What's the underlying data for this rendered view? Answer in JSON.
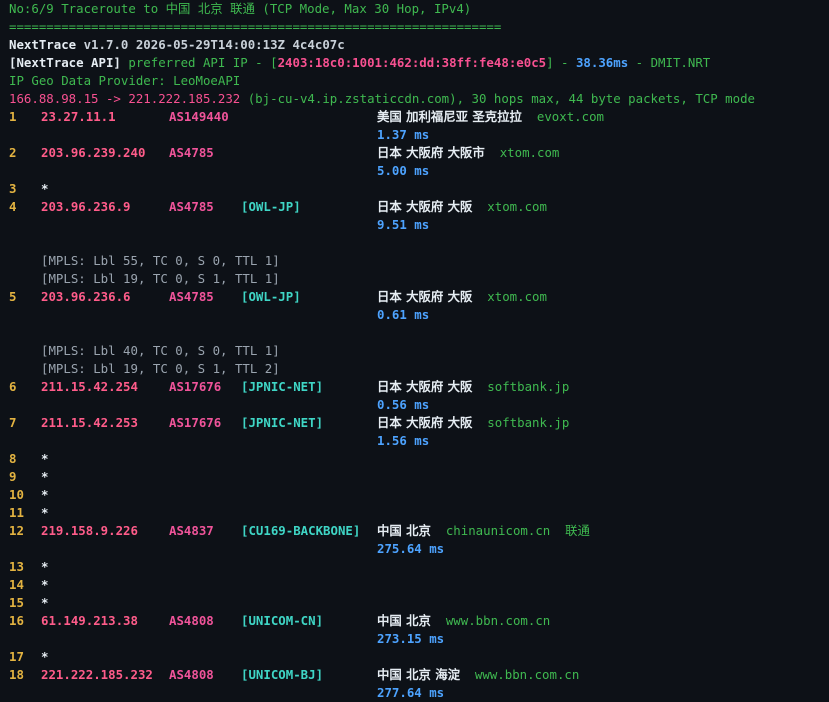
{
  "header": {
    "title": "No:6/9 Traceroute to 中国 北京 联通 (TCP Mode, Max 30 Hop, IPv4)",
    "separator": "==================================================================",
    "version_name": "NextTrace",
    "version_rest": " v1.7.0 2026-05-29T14:00:13Z 4c4c07c",
    "api_label": "[NextTrace API]",
    "api_mid": " preferred API IP - [",
    "api_ip": "2403:18c0:1001:462:dd:38ff:fe48:e0c5",
    "api_after": "] - ",
    "api_latency": "38.36ms",
    "api_end": " - DMIT.NRT",
    "geo_provider": "IP Geo Data Provider: LeoMoeAPI",
    "route_summary": "166.88.98.15 -> 221.222.185.232 (bj-cu-v4.ip.zstaticcdn.com), 30 hops max, 44 byte packets, TCP mode"
  },
  "hops": [
    {
      "num": "1",
      "ip": "23.27.11.1",
      "asn": "AS149440",
      "tag": "",
      "geo": "美国 加利福尼亚 圣克拉拉",
      "domain": "evoxt.com",
      "latency": "1.37 ms",
      "mpls": []
    },
    {
      "num": "2",
      "ip": "203.96.239.240",
      "asn": "AS4785",
      "tag": "",
      "geo": "日本 大阪府 大阪市",
      "domain": "xtom.com",
      "latency": "5.00 ms",
      "mpls": []
    },
    {
      "num": "3",
      "star": "*"
    },
    {
      "num": "4",
      "ip": "203.96.236.9",
      "asn": "AS4785",
      "tag": "[OWL-JP]",
      "geo": "日本 大阪府 大阪",
      "domain": "xtom.com",
      "latency": "9.51 ms",
      "mpls": [
        "[MPLS: Lbl 55, TC 0, S 0, TTL 1]",
        "[MPLS: Lbl 19, TC 0, S 1, TTL 1]"
      ]
    },
    {
      "num": "5",
      "ip": "203.96.236.6",
      "asn": "AS4785",
      "tag": "[OWL-JP]",
      "geo": "日本 大阪府 大阪",
      "domain": "xtom.com",
      "latency": "0.61 ms",
      "mpls": [
        "[MPLS: Lbl 40, TC 0, S 0, TTL 1]",
        "[MPLS: Lbl 19, TC 0, S 1, TTL 2]"
      ]
    },
    {
      "num": "6",
      "ip": "211.15.42.254",
      "asn": "AS17676",
      "tag": "[JPNIC-NET]",
      "geo": "日本 大阪府 大阪",
      "domain": "softbank.jp",
      "latency": "0.56 ms",
      "mpls": []
    },
    {
      "num": "7",
      "ip": "211.15.42.253",
      "asn": "AS17676",
      "tag": "[JPNIC-NET]",
      "geo": "日本 大阪府 大阪",
      "domain": "softbank.jp",
      "latency": "1.56 ms",
      "mpls": []
    },
    {
      "num": "8",
      "star": "*"
    },
    {
      "num": "9",
      "star": "*"
    },
    {
      "num": "10",
      "star": "*"
    },
    {
      "num": "11",
      "star": "*"
    },
    {
      "num": "12",
      "ip": "219.158.9.226",
      "asn": "AS4837",
      "tag": "[CU169-BACKBONE]",
      "geo": "中国 北京",
      "domain": "chinaunicom.cn",
      "isp": "联通",
      "latency": "275.64 ms",
      "mpls": []
    },
    {
      "num": "13",
      "star": "*"
    },
    {
      "num": "14",
      "star": "*"
    },
    {
      "num": "15",
      "star": "*"
    },
    {
      "num": "16",
      "ip": "61.149.213.38",
      "asn": "AS4808",
      "tag": "[UNICOM-CN]",
      "geo": "中国 北京",
      "domain": "www.bbn.com.cn",
      "latency": "273.15 ms",
      "mpls": []
    },
    {
      "num": "17",
      "star": "*"
    },
    {
      "num": "18",
      "ip": "221.222.185.232",
      "asn": "AS4808",
      "tag": "[UNICOM-BJ]",
      "geo": "中国 北京 海淀",
      "domain": "www.bbn.com.cn",
      "latency": "277.64 ms",
      "mpls": []
    }
  ]
}
